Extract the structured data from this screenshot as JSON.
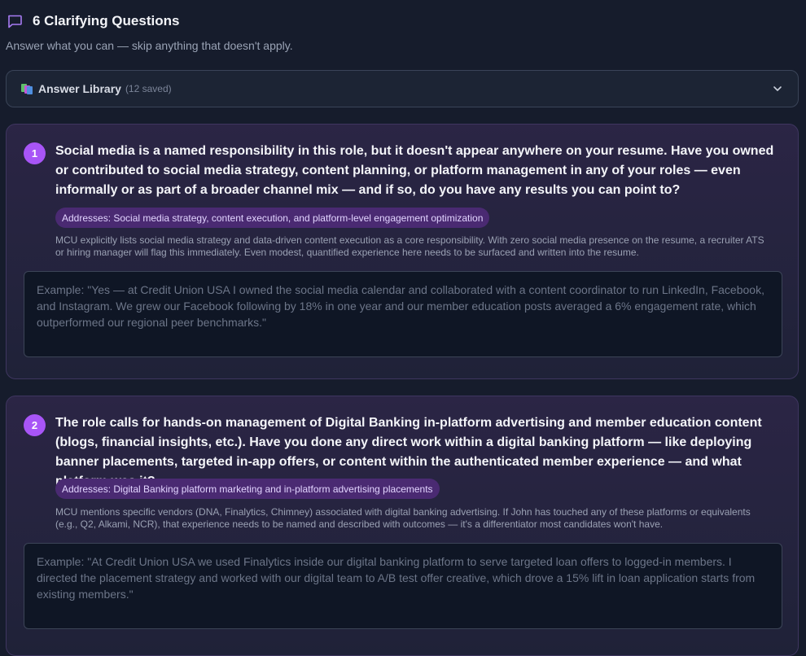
{
  "header": {
    "title": "6 Clarifying Questions",
    "subtitle": "Answer what you can — skip anything that doesn't apply."
  },
  "library": {
    "label": "Answer Library",
    "count": "(12 saved)"
  },
  "colors": {
    "accent": "#a855f7",
    "tag_bg": "#4a2a72",
    "background": "#161c2c"
  },
  "questions": [
    {
      "number": "1",
      "text": "Social media is a named responsibility in this role, but it doesn't appear anywhere on your resume. Have you owned or contributed to social media strategy, content planning, or platform management in any of your roles — even informally or as part of a broader channel mix — and if so, do you have any results you can point to?",
      "addresses": "Addresses: Social media strategy, content execution, and platform-level engagement optimization",
      "rationale": "MCU explicitly lists social media strategy and data-driven content execution as a core responsibility. With zero social media presence on the resume, a recruiter ATS or hiring manager will flag this immediately. Even modest, quantified experience here needs to be surfaced and written into the resume.",
      "answer_value": "",
      "placeholder": "Example: \"Yes — at Credit Union USA I owned the social media calendar and collaborated with a content coordinator to run LinkedIn, Facebook, and Instagram. We grew our Facebook following by 18% in one year and our member education posts averaged a 6% engagement rate, which outperformed our regional peer benchmarks.\""
    },
    {
      "number": "2",
      "text": "The role calls for hands-on management of Digital Banking in-platform advertising and member education content (blogs, financial insights, etc.). Have you done any direct work within a digital banking platform — like deploying banner placements, targeted in-app offers, or content within the authenticated member experience — and what platform was it?",
      "addresses": "Addresses: Digital Banking platform marketing and in-platform advertising placements",
      "rationale": "MCU mentions specific vendors (DNA, Finalytics, Chimney) associated with digital banking advertising. If John has touched any of these platforms or equivalents (e.g., Q2, Alkami, NCR), that experience needs to be named and described with outcomes — it's a differentiator most candidates won't have.",
      "answer_value": "",
      "placeholder": "Example: \"At Credit Union USA we used Finalytics inside our digital banking platform to serve targeted loan offers to logged-in members. I directed the placement strategy and worked with our digital team to A/B test offer creative, which drove a 15% lift in loan application starts from existing members.\""
    }
  ]
}
